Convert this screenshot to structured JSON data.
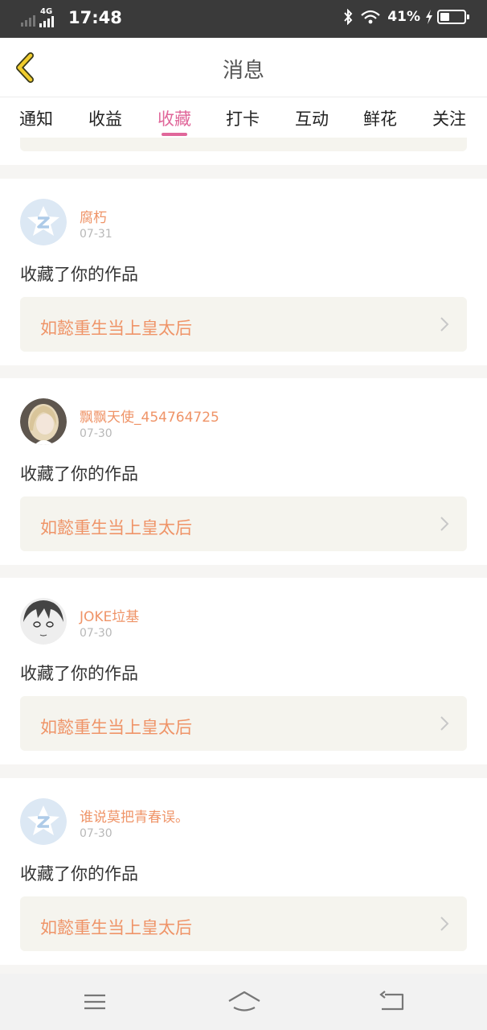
{
  "status_bar": {
    "network": "4G",
    "time": "17:48",
    "battery": "41%",
    "battery_level": 0.41
  },
  "header": {
    "title": "消息"
  },
  "tabs": [
    {
      "label": "通知",
      "active": false
    },
    {
      "label": "收益",
      "active": false
    },
    {
      "label": "收藏",
      "active": true
    },
    {
      "label": "打卡",
      "active": false
    },
    {
      "label": "互动",
      "active": false
    },
    {
      "label": "鲜花",
      "active": false
    },
    {
      "label": "关注",
      "active": false
    }
  ],
  "colors": {
    "accent_pink": "#e0679a",
    "orange_text": "#ef9468",
    "work_bg": "#f5f4ee"
  },
  "messages": [
    {
      "user": "腐朽",
      "date": "07-31",
      "action": "收藏了你的作品",
      "work": "如懿重生当上皇太后",
      "avatar": "default-avatar-icon"
    },
    {
      "user": "飘飘天使_454764725",
      "date": "07-30",
      "action": "收藏了你的作品",
      "work": "如懿重生当上皇太后",
      "avatar": "user-photo-avatar"
    },
    {
      "user": "JOKE垃基",
      "date": "07-30",
      "action": "收藏了你的作品",
      "work": "如懿重生当上皇太后",
      "avatar": "user-sketch-avatar"
    },
    {
      "user": "谁说莫把青春误。",
      "date": "07-30",
      "action": "收藏了你的作品",
      "work": "如懿重生当上皇太后",
      "avatar": "default-avatar-icon"
    }
  ],
  "nav_bar": {
    "menu_icon": "menu-icon",
    "home_icon": "home-icon",
    "back_icon": "return-icon"
  }
}
